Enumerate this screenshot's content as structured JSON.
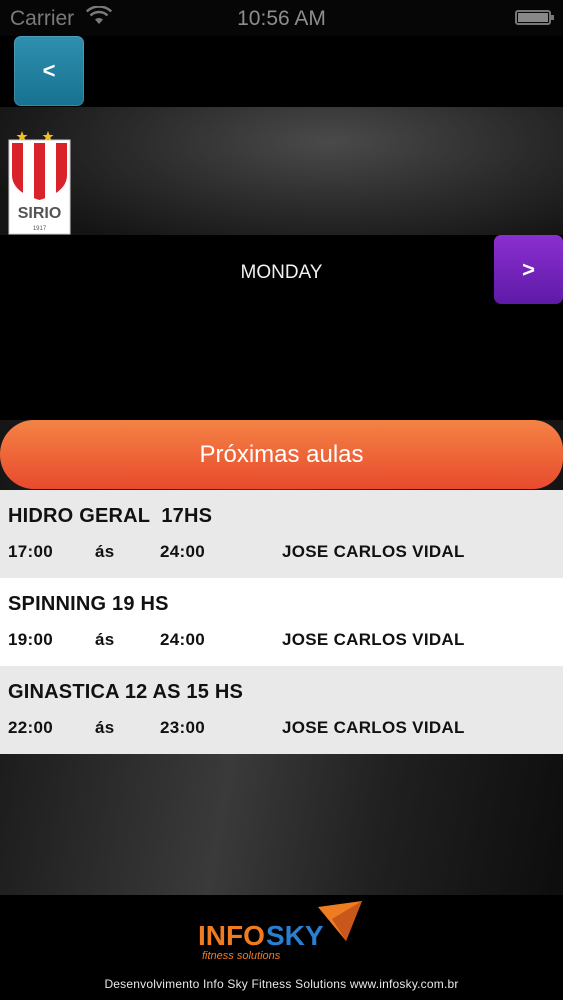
{
  "status_bar": {
    "carrier": "Carrier",
    "time": "10:56 AM"
  },
  "nav": {
    "back_label": "<"
  },
  "logo": {
    "club_text": "SIRIO",
    "club_year": "1917"
  },
  "day_selector": {
    "day": "MONDAY",
    "next_label": ">"
  },
  "section": {
    "button_label": "Próximas aulas"
  },
  "classes": [
    {
      "name": "HIDRO GERAL  17HS",
      "start": "17:00",
      "separator": "ás",
      "end": "24:00",
      "teacher": "JOSE CARLOS VIDAL"
    },
    {
      "name": "SPINNING 19 HS",
      "start": "19:00",
      "separator": "ás",
      "end": "24:00",
      "teacher": "JOSE CARLOS VIDAL"
    },
    {
      "name": "GINASTICA 12 AS 15 HS",
      "start": "22:00",
      "separator": "ás",
      "end": "23:00",
      "teacher": "JOSE CARLOS VIDAL"
    }
  ],
  "footer": {
    "brand_info": "INFO",
    "brand_sky": "SKY",
    "brand_tagline": "fitness solutions",
    "credit": "Desenvolvimento Info Sky Fitness Solutions www.infosky.com.br"
  },
  "colors": {
    "back_button": "#1f7f9f",
    "next_button": "#7324bd",
    "proximas_button": "#ee6a3a",
    "brand_orange": "#f07c22",
    "brand_blue": "#2a7fd0",
    "club_red": "#d8232a"
  }
}
